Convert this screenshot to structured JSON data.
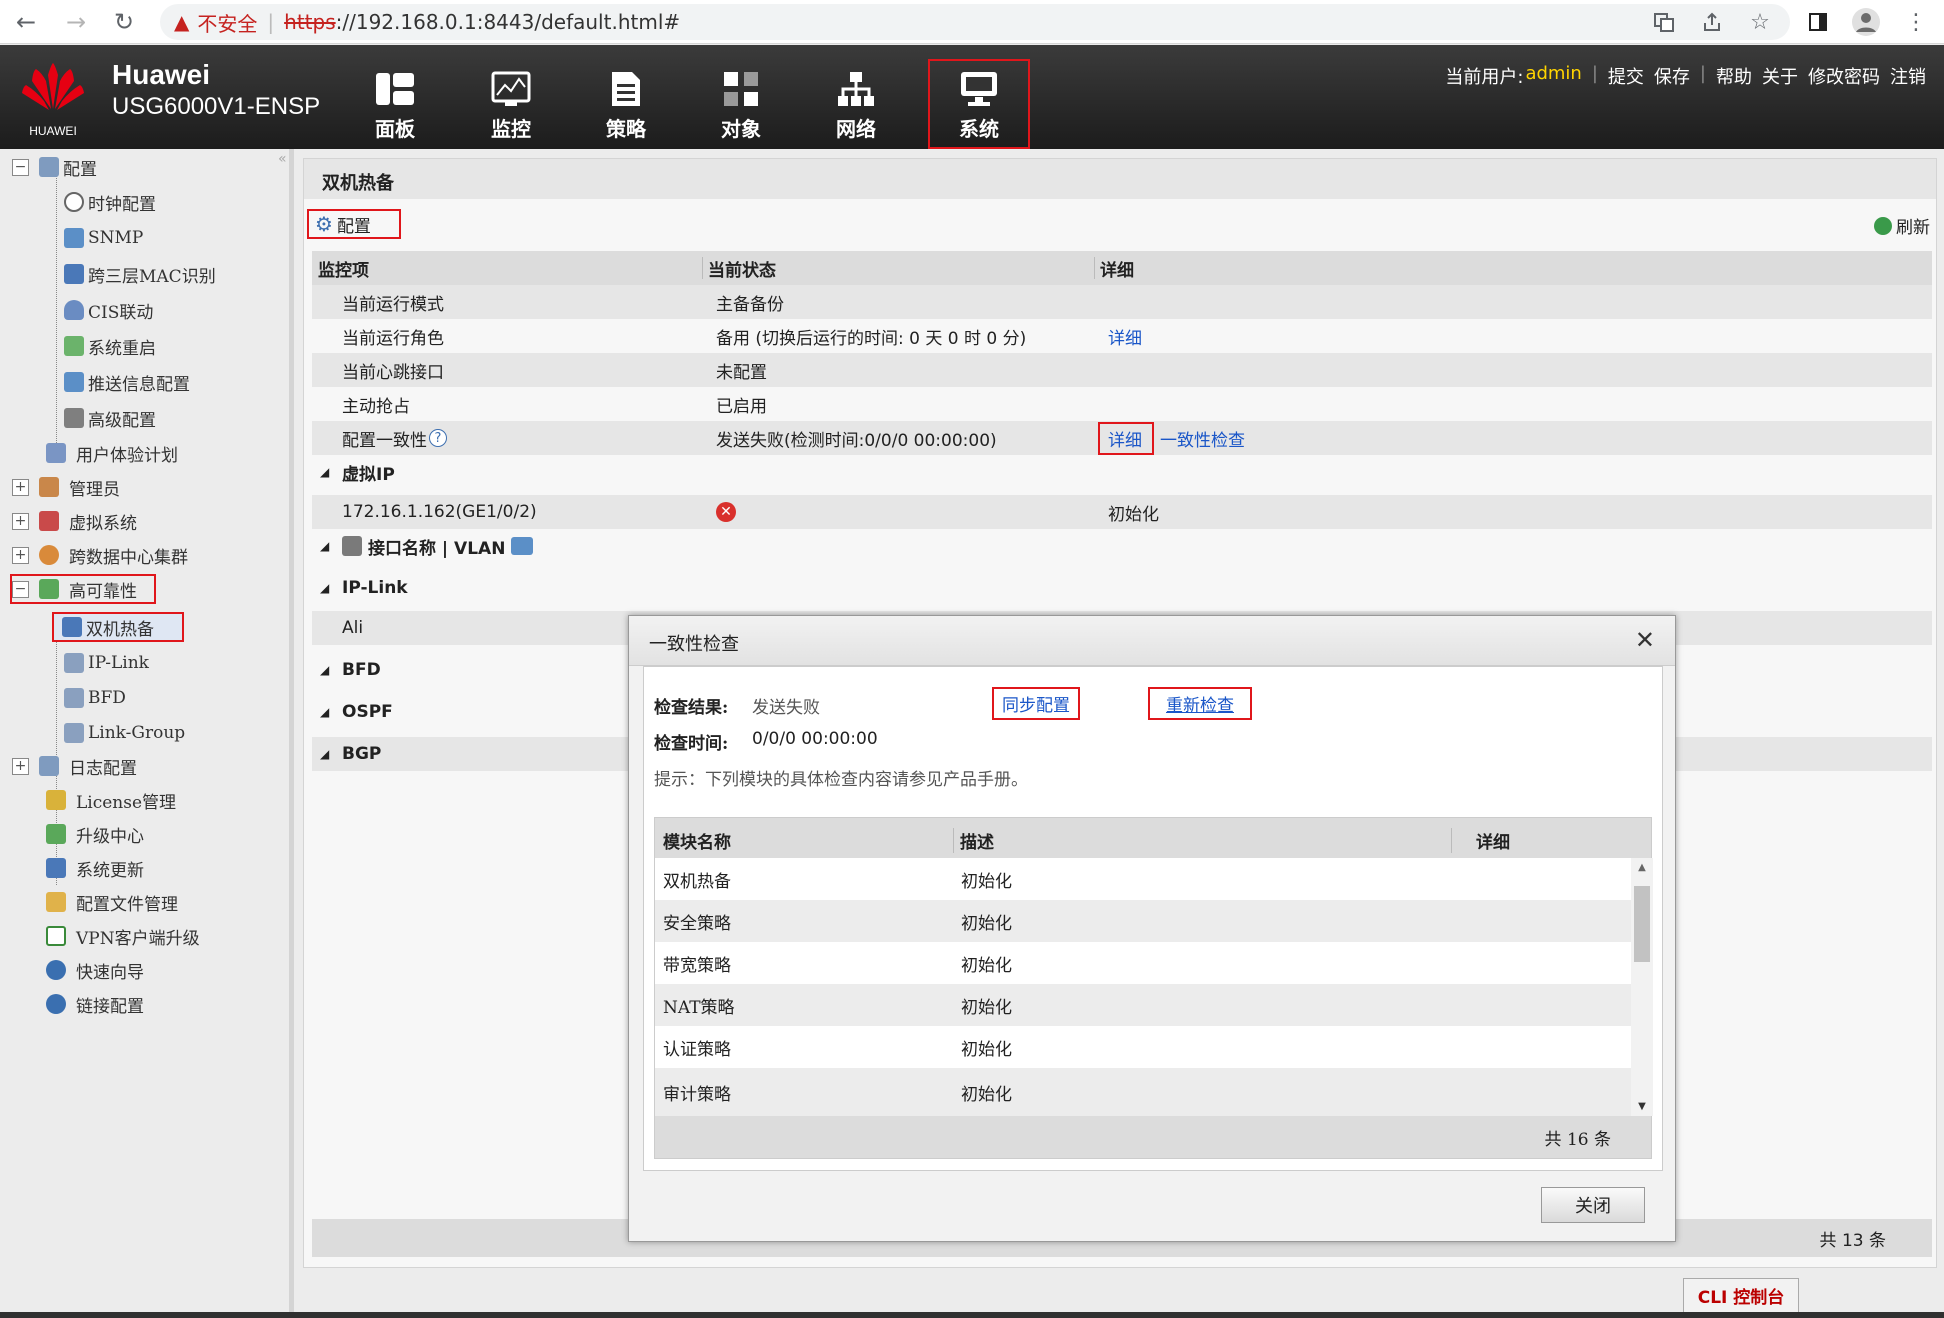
{
  "browser": {
    "insecure_label": "不安全",
    "url_scheme": "https",
    "url_rest": "://192.168.0.1:8443/default.html#"
  },
  "header": {
    "brand": "Huawei",
    "brand_sub": "HUAWEI",
    "model": "USG6000V1-ENSP",
    "nav": [
      {
        "label": "面板",
        "icon": "dashboard-icon"
      },
      {
        "label": "监控",
        "icon": "monitor-chart-icon"
      },
      {
        "label": "策略",
        "icon": "document-icon"
      },
      {
        "label": "对象",
        "icon": "objects-icon"
      },
      {
        "label": "网络",
        "icon": "network-icon"
      },
      {
        "label": "系统",
        "icon": "system-monitor-icon"
      }
    ],
    "user_prefix": "当前用户:",
    "user": "admin",
    "links": [
      "提交",
      "保存",
      "帮助",
      "关于",
      "修改密码",
      "注销"
    ]
  },
  "sidebar": {
    "items": [
      {
        "label": "配置"
      },
      {
        "label": "时钟配置"
      },
      {
        "label": "SNMP"
      },
      {
        "label": "跨三层MAC识别"
      },
      {
        "label": "CIS联动"
      },
      {
        "label": "系统重启"
      },
      {
        "label": "推送信息配置"
      },
      {
        "label": "高级配置"
      },
      {
        "label": "用户体验计划"
      },
      {
        "label": "管理员"
      },
      {
        "label": "虚拟系统"
      },
      {
        "label": "跨数据中心集群"
      },
      {
        "label": "高可靠性"
      },
      {
        "label": "双机热备"
      },
      {
        "label": "IP-Link"
      },
      {
        "label": "BFD"
      },
      {
        "label": "Link-Group"
      },
      {
        "label": "日志配置"
      },
      {
        "label": "License管理"
      },
      {
        "label": "升级中心"
      },
      {
        "label": "系统更新"
      },
      {
        "label": "配置文件管理"
      },
      {
        "label": "VPN客户端升级"
      },
      {
        "label": "快速向导"
      },
      {
        "label": "链接配置"
      }
    ]
  },
  "main": {
    "title": "双机热备",
    "config_btn": "配置",
    "refresh": "刷新",
    "columns": [
      "监控项",
      "当前状态",
      "详细"
    ],
    "rows": [
      {
        "item": "当前运行模式",
        "status": "主备备份",
        "detail": ""
      },
      {
        "item": "当前运行角色",
        "status": "备用 (切换后运行的时间: 0 天 0 时 0 分)",
        "detail": "详细"
      },
      {
        "item": "当前心跳接口",
        "status": "未配置",
        "detail": ""
      },
      {
        "item": "主动抢占",
        "status": "已启用",
        "detail": ""
      },
      {
        "item": "配置一致性",
        "status": "发送失败(检测时间:0/0/0 00:00:00)",
        "detail": "详细",
        "detail2": "一致性检查"
      }
    ],
    "vip_group": "虚拟IP",
    "vip_row": {
      "ip": "172.16.1.162(GE1/0/2)",
      "state": "初始化"
    },
    "iface_group": "接口名称 | VLAN",
    "iplink_group": "IP-Link",
    "iplink_row": "Ali",
    "bfd_group": "BFD",
    "ospf_group": "OSPF",
    "bgp_group": "BGP",
    "total": "共 13 条",
    "cli": "CLI 控制台"
  },
  "modal": {
    "title": "一致性检查",
    "result_label": "检查结果:",
    "result_value": "发送失败",
    "sync_btn": "同步配置",
    "recheck_btn": "重新检查",
    "time_label": "检查时间:",
    "time_value": "0/0/0 00:00:00",
    "hint": "提示：下列模块的具体检查内容请参见产品手册。",
    "columns": [
      "模块名称",
      "描述",
      "详细"
    ],
    "rows": [
      {
        "name": "双机热备",
        "desc": "初始化"
      },
      {
        "name": "安全策略",
        "desc": "初始化"
      },
      {
        "name": "带宽策略",
        "desc": "初始化"
      },
      {
        "name": "NAT策略",
        "desc": "初始化"
      },
      {
        "name": "认证策略",
        "desc": "初始化"
      },
      {
        "name": "审计策略",
        "desc": "初始化"
      }
    ],
    "total": "共 16 条",
    "close_btn": "关闭"
  }
}
